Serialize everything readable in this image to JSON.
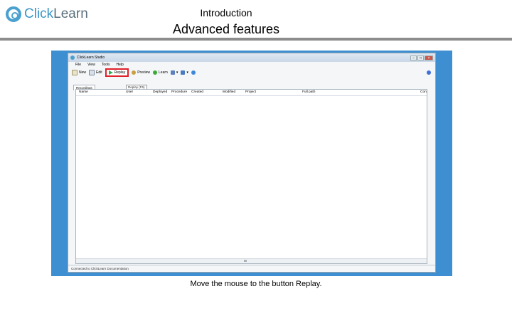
{
  "brand": {
    "logo_text_a": "Click",
    "logo_text_b": "Learn"
  },
  "header": {
    "subtitle": "Introduction",
    "title": "Advanced features"
  },
  "window": {
    "title": "ClickLearn Studio",
    "menu": [
      "File",
      "View",
      "Tools",
      "Help"
    ],
    "toolbar": {
      "new_label": "New",
      "edit_label": "Edit",
      "replay_label": "Replay",
      "preview_label": "Preview",
      "learn_label": "Learn"
    },
    "tooltip": "Replay (F5)",
    "tab_label": "Recordings",
    "columns": [
      "Name",
      "User",
      "Deployed",
      "Procedure",
      "Created",
      "Modified",
      "Project",
      "Full path",
      "Con"
    ],
    "status": "Connected to ClickLearn Documentation"
  },
  "caption": "Move the mouse to the button Replay.",
  "colors": {
    "frame": "#3d8fd2",
    "highlight": "#e0202a",
    "brand": "#3b97c8"
  }
}
